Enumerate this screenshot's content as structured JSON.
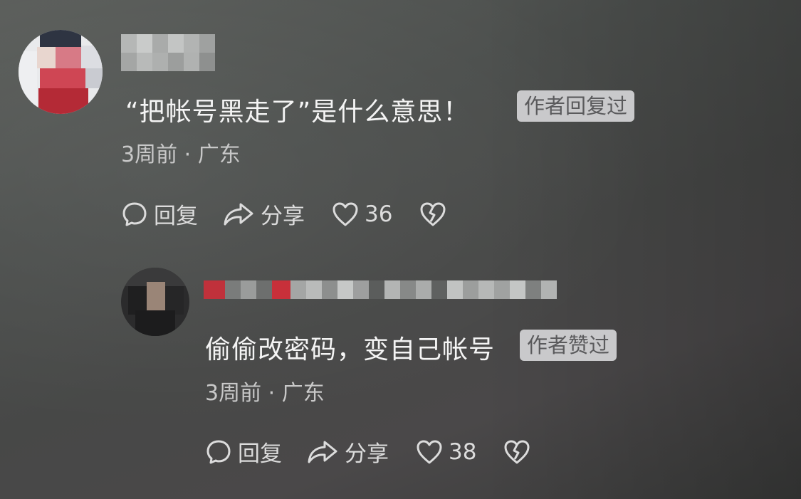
{
  "comments": [
    {
      "text": "“把帐号黑走了”是什么意思！",
      "badge": "作者回复过",
      "meta": "3周前 · 广东",
      "reply_label": "回复",
      "share_label": "分享",
      "likes": "36",
      "icons": [
        "comment-icon",
        "share-arrow-icon",
        "heart-icon",
        "broken-heart-icon"
      ]
    },
    {
      "text": "偷偷改密码，变自己帐号",
      "badge": "作者赞过",
      "meta": "3周前 · 广东",
      "reply_label": "回复",
      "share_label": "分享",
      "likes": "38",
      "icons": [
        "comment-icon",
        "share-arrow-icon",
        "heart-icon",
        "broken-heart-icon"
      ]
    }
  ],
  "colors": {
    "background": "#4c4f4d",
    "text": "#f4f4f4",
    "meta_text": "#c8c8c8",
    "badge_bg": "#c9c9cb",
    "badge_text": "#5a5a5c",
    "mosaic_red": "#c8303a"
  }
}
